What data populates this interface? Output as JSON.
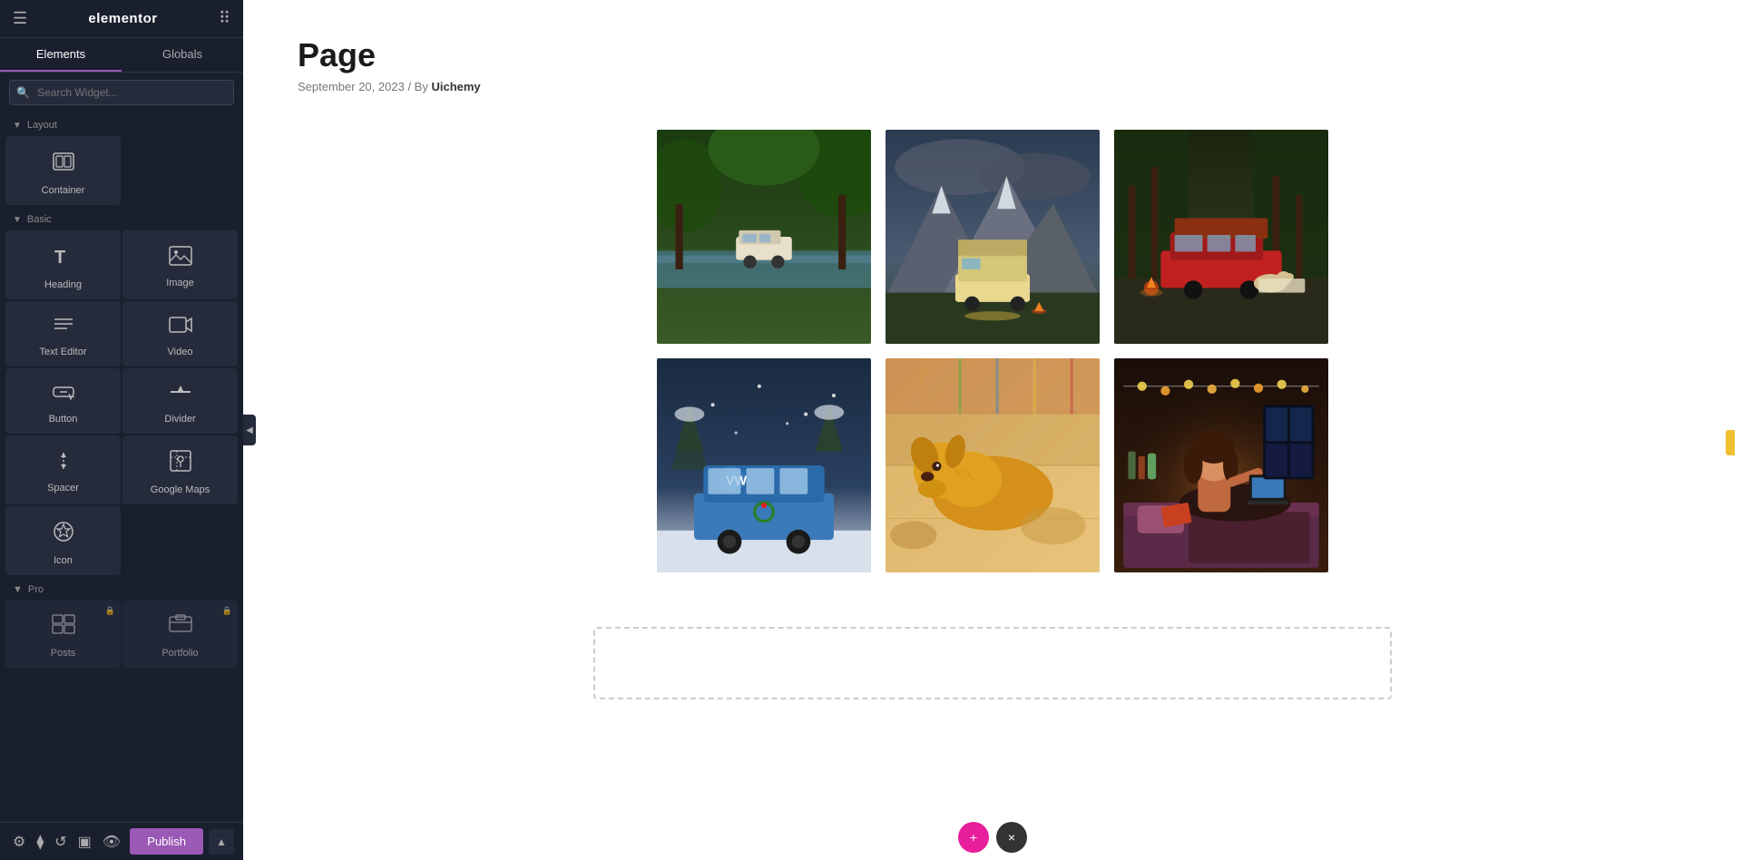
{
  "sidebar": {
    "title": "elementor",
    "tabs": [
      {
        "label": "Elements",
        "active": true
      },
      {
        "label": "Globals",
        "active": false
      }
    ],
    "search_placeholder": "Search Widget...",
    "sections": {
      "layout": {
        "label": "Layout",
        "widgets": [
          {
            "id": "container",
            "label": "Container",
            "icon": "container"
          }
        ]
      },
      "basic": {
        "label": "Basic",
        "widgets": [
          {
            "id": "heading",
            "label": "Heading",
            "icon": "heading"
          },
          {
            "id": "image",
            "label": "Image",
            "icon": "image"
          },
          {
            "id": "text-editor",
            "label": "Text Editor",
            "icon": "text-editor"
          },
          {
            "id": "video",
            "label": "Video",
            "icon": "video"
          },
          {
            "id": "button",
            "label": "Button",
            "icon": "button"
          },
          {
            "id": "divider",
            "label": "Divider",
            "icon": "divider"
          },
          {
            "id": "spacer",
            "label": "Spacer",
            "icon": "spacer"
          },
          {
            "id": "google-maps",
            "label": "Google Maps",
            "icon": "google-maps"
          },
          {
            "id": "icon",
            "label": "Icon",
            "icon": "icon"
          }
        ]
      },
      "pro": {
        "label": "Pro",
        "widgets": [
          {
            "id": "posts",
            "label": "Posts",
            "icon": "posts"
          },
          {
            "id": "portfolio",
            "label": "Portfolio",
            "icon": "portfolio"
          }
        ]
      }
    },
    "bottom_icons": [
      "settings",
      "layers",
      "history",
      "responsive",
      "eye"
    ],
    "publish_label": "Publish",
    "collapse_icon": "◀"
  },
  "canvas": {
    "page_title": "Page",
    "page_date": "September 20, 2023",
    "page_by": "By",
    "page_author": "Uichemy",
    "gallery": {
      "images": [
        {
          "id": "img1",
          "desc": "Van in jungle river",
          "color1": "#2d5a27",
          "color2": "#5a8040"
        },
        {
          "id": "img2",
          "desc": "Mountain camping scene",
          "color1": "#3a4a5c",
          "color2": "#6a7a8c"
        },
        {
          "id": "img3",
          "desc": "Car camping with dog",
          "color1": "#2a3520",
          "color2": "#5c4030"
        },
        {
          "id": "img4",
          "desc": "Blue VW bus in snow",
          "color1": "#4a7aaa",
          "color2": "#8ab4d4"
        },
        {
          "id": "img5",
          "desc": "Dog on blanket",
          "color1": "#c8a870",
          "color2": "#e8c890"
        },
        {
          "id": "img6",
          "desc": "Woman reading in van",
          "color1": "#3a2010",
          "color2": "#8a5030"
        }
      ]
    }
  },
  "bottom_controls": {
    "btn1_icon": "+",
    "btn2_icon": "×"
  }
}
